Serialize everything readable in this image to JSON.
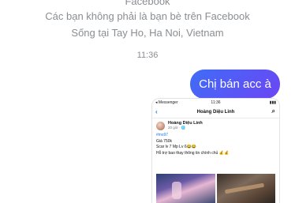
{
  "header": {
    "title": "Facebook",
    "line1": "Các bạn không phải là bạn bè trên Facebook",
    "line2": "Sống tại Tay Ho, Ha Noi, Vietnam"
  },
  "time": "11:36",
  "message": {
    "text": "Chị bán acc à"
  },
  "screenshot": {
    "statusbar": {
      "left": "◂ Messenger",
      "time": "11:36",
      "right": "▮▮▮"
    },
    "nav": {
      "back": "‹",
      "name": "Hoàng Diệu Linh",
      "search": "⌕"
    },
    "post": {
      "author": "Hoàng Diệu Linh",
      "meta": "20 giờ · 🌐",
      "hashtag": "#ms97",
      "lines": [
        "Giá 750k",
        "Scar lv 7 Mp Lv 6😂😂",
        "Hỗ trợ bao thay thông tin chính chủ 💰💰"
      ]
    }
  }
}
